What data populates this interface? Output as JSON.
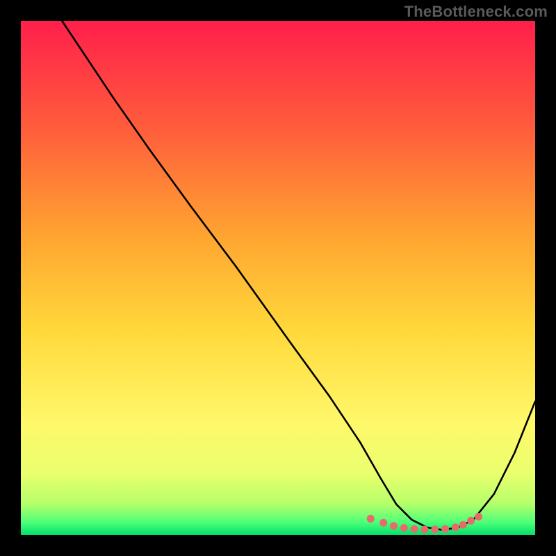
{
  "watermark": "TheBottleneck.com",
  "chart_data": {
    "type": "line",
    "title": "",
    "xlabel": "",
    "ylabel": "",
    "xlim": [
      0,
      100
    ],
    "ylim": [
      0,
      100
    ],
    "grid": false,
    "legend": false,
    "annotations": [],
    "gradient_stops": [
      {
        "offset": 0.0,
        "color": "#ff1f4b"
      },
      {
        "offset": 0.2,
        "color": "#ff5a3c"
      },
      {
        "offset": 0.42,
        "color": "#ffa531"
      },
      {
        "offset": 0.6,
        "color": "#ffd83a"
      },
      {
        "offset": 0.78,
        "color": "#fff86a"
      },
      {
        "offset": 0.88,
        "color": "#eaff6e"
      },
      {
        "offset": 0.94,
        "color": "#b4ff6a"
      },
      {
        "offset": 0.975,
        "color": "#4dff78"
      },
      {
        "offset": 1.0,
        "color": "#00e06a"
      }
    ],
    "series": [
      {
        "name": "curve",
        "x": [
          8,
          12,
          18,
          25,
          33,
          42,
          52,
          60,
          66,
          70,
          73,
          76,
          79,
          82,
          85,
          88,
          92,
          96,
          100
        ],
        "values": [
          100,
          94,
          85,
          75,
          64,
          52,
          38,
          27,
          18,
          11,
          6,
          3,
          1.5,
          1,
          1.5,
          3,
          8,
          16,
          26
        ]
      }
    ],
    "markers": {
      "name": "highlight-dots",
      "color": "#e86b6b",
      "x": [
        68,
        70.5,
        72.5,
        74.5,
        76.5,
        78.5,
        80.5,
        82.5,
        84.5,
        86,
        87.5,
        89
      ],
      "values": [
        3.2,
        2.4,
        1.8,
        1.4,
        1.2,
        1.1,
        1.1,
        1.2,
        1.5,
        2.0,
        2.8,
        3.6
      ]
    }
  }
}
